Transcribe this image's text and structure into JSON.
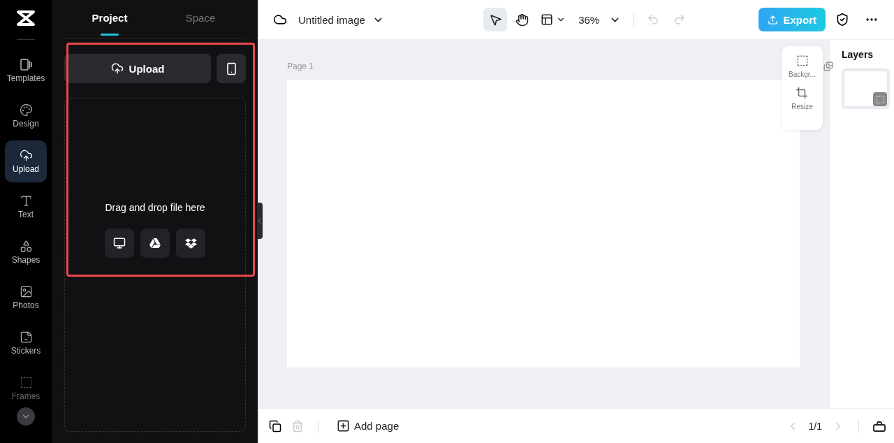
{
  "sidebar": {
    "items": [
      {
        "label": "Templates",
        "kind": "templates",
        "selected": false,
        "dimmed": false
      },
      {
        "label": "Design",
        "kind": "design",
        "selected": false,
        "dimmed": false
      },
      {
        "label": "Upload",
        "kind": "upload",
        "selected": true,
        "dimmed": false
      },
      {
        "label": "Text",
        "kind": "text",
        "selected": false,
        "dimmed": false
      },
      {
        "label": "Shapes",
        "kind": "shapes",
        "selected": false,
        "dimmed": false
      },
      {
        "label": "Photos",
        "kind": "photos",
        "selected": false,
        "dimmed": false
      },
      {
        "label": "Stickers",
        "kind": "stickers",
        "selected": false,
        "dimmed": false
      },
      {
        "label": "Frames",
        "kind": "frames",
        "selected": false,
        "dimmed": true
      }
    ]
  },
  "panel": {
    "tabs": [
      {
        "label": "Project",
        "selected": true
      },
      {
        "label": "Space",
        "selected": false
      }
    ],
    "upload_button": "Upload",
    "drop_text": "Drag and drop file here",
    "highlighted": true
  },
  "topbar": {
    "title": "Untitled image",
    "tools": [
      {
        "kind": "select",
        "selected": true
      },
      {
        "kind": "hand",
        "selected": false
      }
    ],
    "zoom": "36%",
    "undo_disabled": true,
    "redo_disabled": true,
    "export": "Export"
  },
  "canvas": {
    "page_label": "Page 1",
    "float_menu": [
      {
        "kind": "background",
        "label": "Backgr..."
      },
      {
        "kind": "resize",
        "label": "Resize"
      }
    ]
  },
  "layers": {
    "title": "Layers"
  },
  "bottombar": {
    "add_page": "Add page",
    "pager": "1/1",
    "delete_disabled": true
  }
}
